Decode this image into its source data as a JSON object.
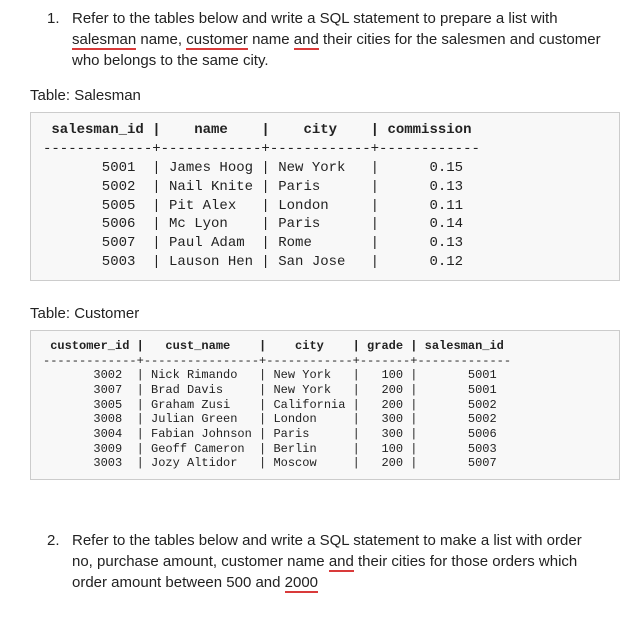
{
  "questions": [
    {
      "number": "1.",
      "text_parts": [
        "Refer to the tables below and write a SQL statement to prepare a list with ",
        "salesman",
        " name, ",
        "customer",
        " name ",
        "and",
        " their cities for the salesmen and customer who belongs to the same city."
      ],
      "underline_indices": [
        1,
        3,
        5
      ]
    },
    {
      "number": "2.",
      "text_parts": [
        "Refer to the tables below and write a SQL statement to make a list with order no, purchase amount, customer name ",
        "and",
        " their cities for those orders which order amount between 500 and ",
        "2000"
      ],
      "underline_indices": [
        1,
        3
      ]
    }
  ],
  "tables": [
    {
      "label": "Table: Salesman",
      "header": " salesman_id |    name    |    city    | commission",
      "divider": "-------------+------------+------------+------------",
      "rows": [
        "       5001  | James Hoog | New York   |      0.15",
        "       5002  | Nail Knite | Paris      |      0.13",
        "       5005  | Pit Alex   | London     |      0.11",
        "       5006  | Mc Lyon    | Paris      |      0.14",
        "       5007  | Paul Adam  | Rome       |      0.13",
        "       5003  | Lauson Hen | San Jose   |      0.12"
      ]
    },
    {
      "label": "Table: Customer",
      "header": " customer_id |   cust_name    |    city    | grade | salesman_id",
      "divider": "-------------+----------------+------------+-------+-------------",
      "rows": [
        "       3002  | Nick Rimando   | New York   |   100 |       5001",
        "       3007  | Brad Davis     | New York   |   200 |       5001",
        "       3005  | Graham Zusi    | California |   200 |       5002",
        "       3008  | Julian Green   | London     |   300 |       5002",
        "       3004  | Fabian Johnson | Paris      |   300 |       5006",
        "       3009  | Geoff Cameron  | Berlin     |   100 |       5003",
        "       3003  | Jozy Altidor   | Moscow     |   200 |       5007"
      ]
    }
  ]
}
